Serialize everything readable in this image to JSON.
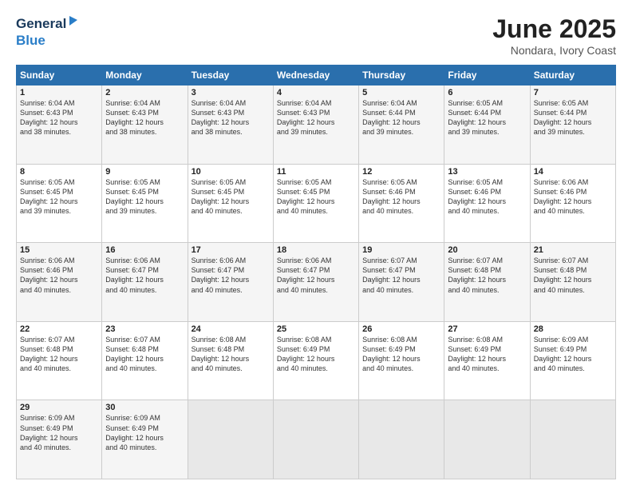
{
  "header": {
    "logo_part1": "General",
    "logo_part2": "Blue",
    "month_title": "June 2025",
    "location": "Nondara, Ivory Coast"
  },
  "days_of_week": [
    "Sunday",
    "Monday",
    "Tuesday",
    "Wednesday",
    "Thursday",
    "Friday",
    "Saturday"
  ],
  "weeks": [
    [
      {
        "day": "1",
        "info": "Sunrise: 6:04 AM\nSunset: 6:43 PM\nDaylight: 12 hours\nand 38 minutes."
      },
      {
        "day": "2",
        "info": "Sunrise: 6:04 AM\nSunset: 6:43 PM\nDaylight: 12 hours\nand 38 minutes."
      },
      {
        "day": "3",
        "info": "Sunrise: 6:04 AM\nSunset: 6:43 PM\nDaylight: 12 hours\nand 38 minutes."
      },
      {
        "day": "4",
        "info": "Sunrise: 6:04 AM\nSunset: 6:43 PM\nDaylight: 12 hours\nand 39 minutes."
      },
      {
        "day": "5",
        "info": "Sunrise: 6:04 AM\nSunset: 6:44 PM\nDaylight: 12 hours\nand 39 minutes."
      },
      {
        "day": "6",
        "info": "Sunrise: 6:05 AM\nSunset: 6:44 PM\nDaylight: 12 hours\nand 39 minutes."
      },
      {
        "day": "7",
        "info": "Sunrise: 6:05 AM\nSunset: 6:44 PM\nDaylight: 12 hours\nand 39 minutes."
      }
    ],
    [
      {
        "day": "8",
        "info": "Sunrise: 6:05 AM\nSunset: 6:45 PM\nDaylight: 12 hours\nand 39 minutes."
      },
      {
        "day": "9",
        "info": "Sunrise: 6:05 AM\nSunset: 6:45 PM\nDaylight: 12 hours\nand 39 minutes."
      },
      {
        "day": "10",
        "info": "Sunrise: 6:05 AM\nSunset: 6:45 PM\nDaylight: 12 hours\nand 40 minutes."
      },
      {
        "day": "11",
        "info": "Sunrise: 6:05 AM\nSunset: 6:45 PM\nDaylight: 12 hours\nand 40 minutes."
      },
      {
        "day": "12",
        "info": "Sunrise: 6:05 AM\nSunset: 6:46 PM\nDaylight: 12 hours\nand 40 minutes."
      },
      {
        "day": "13",
        "info": "Sunrise: 6:05 AM\nSunset: 6:46 PM\nDaylight: 12 hours\nand 40 minutes."
      },
      {
        "day": "14",
        "info": "Sunrise: 6:06 AM\nSunset: 6:46 PM\nDaylight: 12 hours\nand 40 minutes."
      }
    ],
    [
      {
        "day": "15",
        "info": "Sunrise: 6:06 AM\nSunset: 6:46 PM\nDaylight: 12 hours\nand 40 minutes."
      },
      {
        "day": "16",
        "info": "Sunrise: 6:06 AM\nSunset: 6:47 PM\nDaylight: 12 hours\nand 40 minutes."
      },
      {
        "day": "17",
        "info": "Sunrise: 6:06 AM\nSunset: 6:47 PM\nDaylight: 12 hours\nand 40 minutes."
      },
      {
        "day": "18",
        "info": "Sunrise: 6:06 AM\nSunset: 6:47 PM\nDaylight: 12 hours\nand 40 minutes."
      },
      {
        "day": "19",
        "info": "Sunrise: 6:07 AM\nSunset: 6:47 PM\nDaylight: 12 hours\nand 40 minutes."
      },
      {
        "day": "20",
        "info": "Sunrise: 6:07 AM\nSunset: 6:48 PM\nDaylight: 12 hours\nand 40 minutes."
      },
      {
        "day": "21",
        "info": "Sunrise: 6:07 AM\nSunset: 6:48 PM\nDaylight: 12 hours\nand 40 minutes."
      }
    ],
    [
      {
        "day": "22",
        "info": "Sunrise: 6:07 AM\nSunset: 6:48 PM\nDaylight: 12 hours\nand 40 minutes."
      },
      {
        "day": "23",
        "info": "Sunrise: 6:07 AM\nSunset: 6:48 PM\nDaylight: 12 hours\nand 40 minutes."
      },
      {
        "day": "24",
        "info": "Sunrise: 6:08 AM\nSunset: 6:48 PM\nDaylight: 12 hours\nand 40 minutes."
      },
      {
        "day": "25",
        "info": "Sunrise: 6:08 AM\nSunset: 6:49 PM\nDaylight: 12 hours\nand 40 minutes."
      },
      {
        "day": "26",
        "info": "Sunrise: 6:08 AM\nSunset: 6:49 PM\nDaylight: 12 hours\nand 40 minutes."
      },
      {
        "day": "27",
        "info": "Sunrise: 6:08 AM\nSunset: 6:49 PM\nDaylight: 12 hours\nand 40 minutes."
      },
      {
        "day": "28",
        "info": "Sunrise: 6:09 AM\nSunset: 6:49 PM\nDaylight: 12 hours\nand 40 minutes."
      }
    ],
    [
      {
        "day": "29",
        "info": "Sunrise: 6:09 AM\nSunset: 6:49 PM\nDaylight: 12 hours\nand 40 minutes."
      },
      {
        "day": "30",
        "info": "Sunrise: 6:09 AM\nSunset: 6:49 PM\nDaylight: 12 hours\nand 40 minutes."
      },
      {
        "day": "",
        "info": ""
      },
      {
        "day": "",
        "info": ""
      },
      {
        "day": "",
        "info": ""
      },
      {
        "day": "",
        "info": ""
      },
      {
        "day": "",
        "info": ""
      }
    ]
  ]
}
